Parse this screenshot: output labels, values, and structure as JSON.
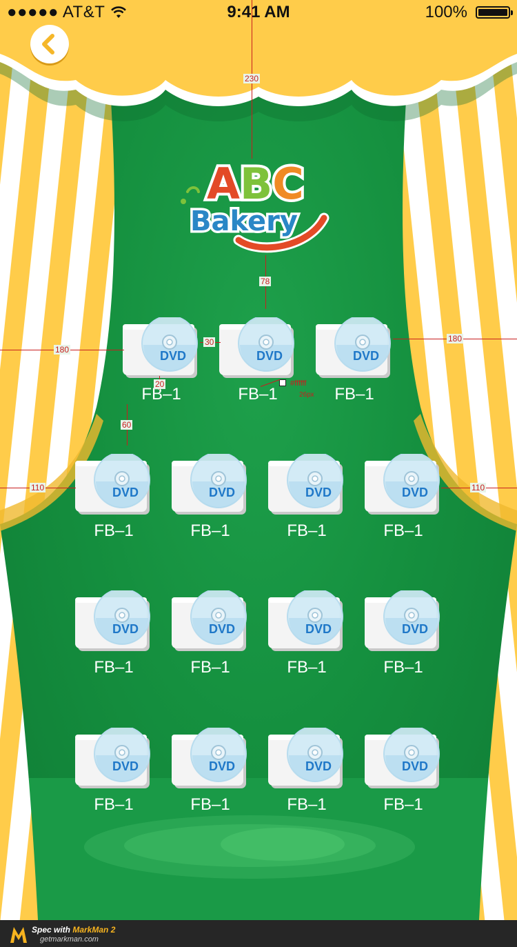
{
  "status_bar": {
    "carrier": "●●●●● AT&T",
    "time": "9:41 AM",
    "battery": "100%"
  },
  "logo": {
    "line1": "ABC",
    "line2": "Bakery"
  },
  "dvd_items": [
    {
      "label": "FB–1",
      "disc_text": "DVD"
    },
    {
      "label": "FB–1",
      "disc_text": "DVD"
    },
    {
      "label": "FB–1",
      "disc_text": "DVD"
    },
    {
      "label": "FB–1",
      "disc_text": "DVD"
    },
    {
      "label": "FB–1",
      "disc_text": "DVD"
    },
    {
      "label": "FB–1",
      "disc_text": "DVD"
    },
    {
      "label": "FB–1",
      "disc_text": "DVD"
    },
    {
      "label": "FB–1",
      "disc_text": "DVD"
    },
    {
      "label": "FB–1",
      "disc_text": "DVD"
    },
    {
      "label": "FB–1",
      "disc_text": "DVD"
    },
    {
      "label": "FB–1",
      "disc_text": "DVD"
    },
    {
      "label": "FB–1",
      "disc_text": "DVD"
    },
    {
      "label": "FB–1",
      "disc_text": "DVD"
    },
    {
      "label": "FB–1",
      "disc_text": "DVD"
    },
    {
      "label": "FB–1",
      "disc_text": "DVD"
    }
  ],
  "annotations": {
    "top_to_logo": "230",
    "logo_to_row": "78",
    "row1_left_margin": "180",
    "row1_right_margin": "180",
    "row1_gap": "30",
    "icon_to_label": "20",
    "row_gap": "60",
    "row2_left_margin": "110",
    "row2_right_margin": "110",
    "text_color": "#ffffff",
    "text_size": "26px"
  },
  "footer": {
    "title_prefix": "Spec with ",
    "title_brand": "MarkMan 2",
    "url": "getmarkman.com"
  },
  "colors": {
    "stage_green": "#128a3e",
    "curtain_yellow": "#ffcc4a",
    "curtain_white": "#ffffff",
    "annotation_red": "#c81e1e"
  }
}
